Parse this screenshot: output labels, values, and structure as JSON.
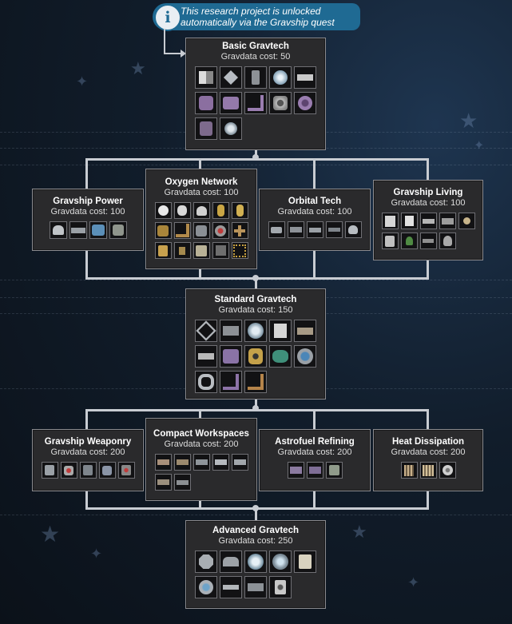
{
  "notice": {
    "icon": "info-icon",
    "line1": "This research project is unlocked",
    "line2": "automatically via the Gravship quest"
  },
  "colors": {
    "node_bg": "#2a2a2c",
    "node_border": "#8a8a8e",
    "connector": "#c8ccd2",
    "notice_bg": "#1f6a93"
  },
  "nodes": {
    "basic": {
      "title": "Basic Gravtech",
      "cost": "Gravdata cost: 50"
    },
    "power": {
      "title": "Gravship Power",
      "cost": "Gravdata cost: 100"
    },
    "oxygen": {
      "title": "Oxygen Network",
      "cost": "Gravdata cost: 100"
    },
    "orbital": {
      "title": "Orbital Tech",
      "cost": "Gravdata cost: 100"
    },
    "living": {
      "title": "Gravship Living",
      "cost": "Gravdata cost: 100"
    },
    "standard": {
      "title": "Standard Gravtech",
      "cost": "Gravdata cost: 150"
    },
    "weaponry": {
      "title": "Gravship Weaponry",
      "cost": "Gravdata cost: 200"
    },
    "compact": {
      "title": "Compact Workspaces",
      "cost": "Gravdata cost: 200"
    },
    "astrofuel": {
      "title": "Astrofuel Refining",
      "cost": "Gravdata cost: 200"
    },
    "heat": {
      "title": "Heat Dissipation",
      "cost": "Gravdata cost: 200"
    },
    "advanced": {
      "title": "Advanced Gravtech",
      "cost": "Gravdata cost: 250"
    }
  }
}
